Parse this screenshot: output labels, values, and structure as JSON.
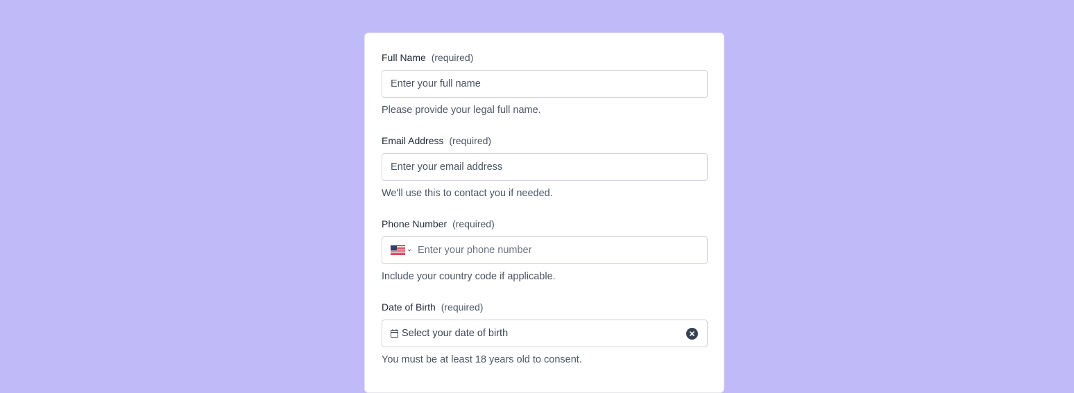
{
  "fields": {
    "full_name": {
      "label": "Full Name",
      "required": "(required)",
      "placeholder": "Enter your full name",
      "helper": "Please provide your legal full name."
    },
    "email": {
      "label": "Email Address",
      "required": "(required)",
      "placeholder": "Enter your email address",
      "helper": "We'll use this to contact you if needed."
    },
    "phone": {
      "label": "Phone Number",
      "required": "(required)",
      "placeholder": "Enter your phone number",
      "country_icon": "us-flag-icon",
      "helper": "Include your country code if applicable."
    },
    "dob": {
      "label": "Date of Birth",
      "required": "(required)",
      "placeholder": "Select your date of birth",
      "helper": "You must be at least 18 years old to consent."
    }
  },
  "colors": {
    "background": "#c0baf9",
    "card": "#ffffff",
    "border": "#d1d5db",
    "label": "#1f2937",
    "muted": "#4b5563"
  }
}
